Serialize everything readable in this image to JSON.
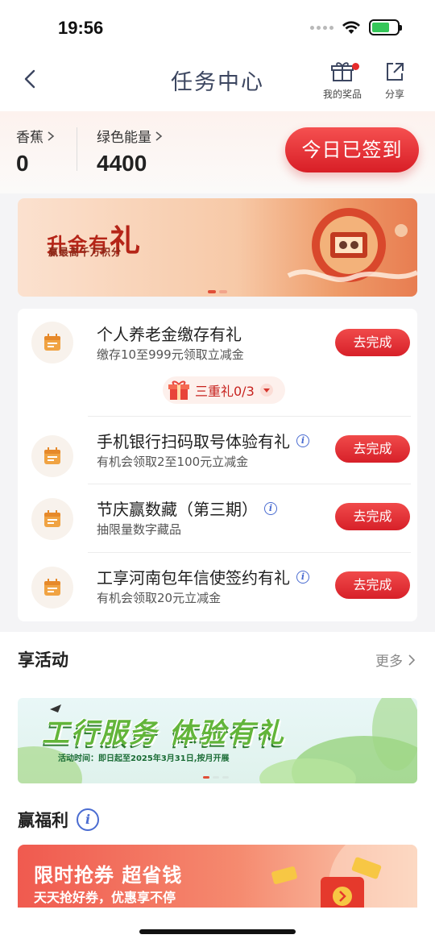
{
  "status_bar": {
    "time": "19:56"
  },
  "nav": {
    "title": "任务中心",
    "my_prizes_label": "我的奖品",
    "share_label": "分享"
  },
  "points": {
    "banana_label": "香蕉",
    "banana_value": "0",
    "energy_label": "绿色能量",
    "energy_value": "4400",
    "signin_label": "今日已签到"
  },
  "top_banner": {
    "title_a": "升金有",
    "title_b": "礼",
    "subtitle": "赢最高千万积分"
  },
  "tasks": [
    {
      "title": "个人养老金缴存有礼",
      "subtitle": "缴存10至999元领取立减金",
      "button": "去完成"
    },
    {
      "title": "手机银行扫码取号体验有礼",
      "subtitle": "有机会领取2至100元立减金",
      "button": "去完成"
    },
    {
      "title": "节庆赢数藏（第三期）",
      "subtitle": "抽限量数字藏品",
      "button": "去完成"
    },
    {
      "title": "工享河南包年信使签约有礼",
      "subtitle": "有机会领取20元立减金",
      "button": "去完成"
    }
  ],
  "triple_gift": {
    "label": "三重礼0/3"
  },
  "activities": {
    "title": "享活动",
    "more": "更多",
    "banner_headline": "工行服务 体验有礼",
    "banner_date": "活动时间：即日起至2025年3月31日,按月开展"
  },
  "welfare": {
    "title": "赢福利",
    "banner_title": "限时抢券 超省钱",
    "banner_sub": "天天抢好券，优惠享不停"
  },
  "colors": {
    "accent_red": "#d81e26",
    "title_navy": "#3c4660",
    "info_blue": "#4a6cd1",
    "task_icon_orange": "#f0a343"
  }
}
